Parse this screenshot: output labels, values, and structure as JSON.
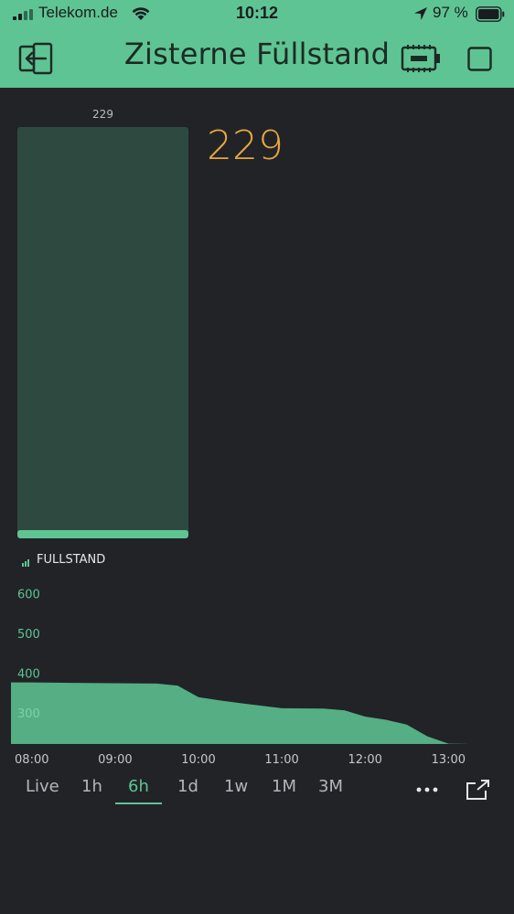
{
  "status_bar": {
    "carrier": "Telekom.de",
    "time": "10:12",
    "battery_percent": "97 %",
    "icons": [
      "signal-icon",
      "wifi-icon",
      "location-arrow-icon",
      "battery-icon"
    ]
  },
  "header": {
    "title": "Zisterne Füllstand",
    "icons": [
      "back-icon",
      "device-icon",
      "stop-icon"
    ]
  },
  "level_widget": {
    "label": "229",
    "value": 229,
    "fill_fraction": 0.02
  },
  "value_display": {
    "value": "229"
  },
  "colors": {
    "accent": "#5fc493",
    "background": "#212327",
    "value": "#e9a541",
    "widget_bg": "#2e4a40"
  },
  "chart_legend": {
    "label": "FULLSTAND"
  },
  "chart_data": {
    "type": "area",
    "title": "",
    "xlabel": "",
    "ylabel": "",
    "series": [
      {
        "name": "FULLSTAND",
        "x": [
          "07:45",
          "08:00",
          "08:30",
          "09:00",
          "09:30",
          "09:45",
          "10:00",
          "10:15",
          "10:30",
          "11:00",
          "11:30",
          "11:45",
          "12:00",
          "12:15",
          "12:30",
          "12:45",
          "13:00",
          "13:15",
          "13:30"
        ],
        "y": [
          390,
          390,
          389,
          388,
          387,
          382,
          353,
          345,
          338,
          325,
          324,
          320,
          304,
          296,
          284,
          254,
          236,
          235,
          235
        ]
      }
    ],
    "x_ticks": [
      "08:00",
      "09:00",
      "10:00",
      "11:00",
      "12:00",
      "13:00"
    ],
    "y_ticks": [
      300,
      400,
      500,
      600
    ],
    "xlim": [
      "07:45",
      "13:38"
    ],
    "ylim": [
      235,
      640
    ],
    "grid": false
  },
  "period_tabs": {
    "items": [
      "Live",
      "1h",
      "6h",
      "1d",
      "1w",
      "1M",
      "3M"
    ],
    "active": "6h",
    "icons": [
      "more-icon",
      "expand-icon"
    ]
  }
}
